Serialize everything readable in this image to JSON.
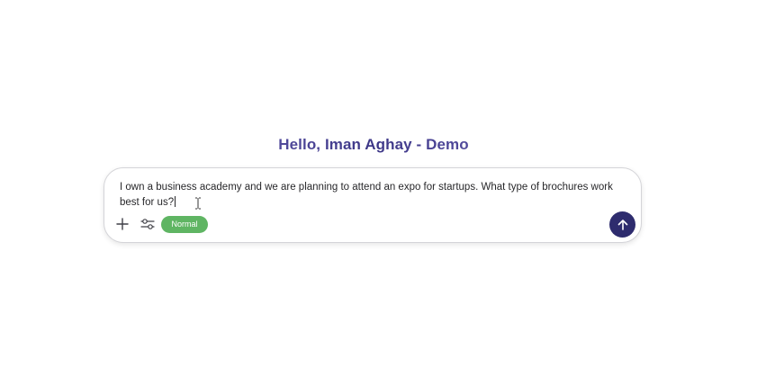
{
  "header": {
    "greeting": "Hello, Iman Aghay - Demo"
  },
  "composer": {
    "prompt_text": "I own a business academy and we are planning to attend an expo for startups. What type of brochures work best for us?",
    "mode_label": "Normal",
    "icons": {
      "add": "plus-icon",
      "settings": "sliders-icon",
      "send": "arrow-up-icon"
    }
  },
  "colors": {
    "greeting_gradient_light": "#8a7fd6",
    "greeting_gradient_dark": "#3d3787",
    "mode_pill": "#5fb563",
    "send_button": "#2e2c6e"
  }
}
